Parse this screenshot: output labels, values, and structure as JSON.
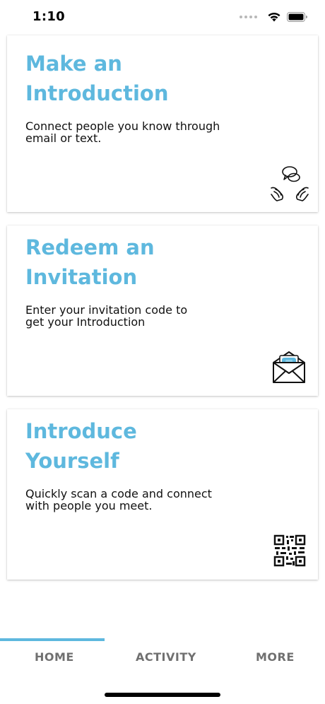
{
  "status_bar": {
    "time": "1:10"
  },
  "cards": [
    {
      "title_line1": "Make an",
      "title_line2": "Introduction",
      "description_line1": "Connect people you know through",
      "description_line2": "email or text.",
      "icon": "chat-handshake-icon"
    },
    {
      "title_line1": "Redeem an",
      "title_line2": "Invitation",
      "description_line1": "Enter your invitation code to",
      "description_line2": "get your Introduction",
      "icon": "envelope-invitation-icon"
    },
    {
      "title_line1": "Introduce",
      "title_line2": "Yourself",
      "description_line1": "Quickly scan a code and connect",
      "description_line2": "with people you meet.",
      "icon": "qr-code-icon"
    }
  ],
  "tabs": {
    "home": "HOME",
    "activity": "ACTIVITY",
    "more": "MORE",
    "active": "home"
  },
  "colors": {
    "accent": "#5eb8de",
    "tab_inactive": "#707070"
  }
}
